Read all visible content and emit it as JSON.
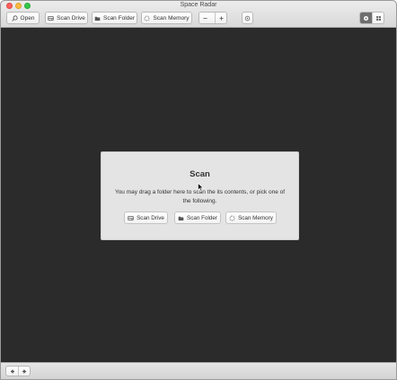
{
  "window": {
    "title": "Space Radar"
  },
  "toolbar": {
    "open_label": "Open",
    "scan_drive_label": "Scan Drive",
    "scan_folder_label": "Scan Folder",
    "scan_memory_label": "Scan Memory",
    "zoom_out_icon": "minus-icon",
    "zoom_in_icon": "plus-icon",
    "target_icon": "target-icon",
    "view_modes": [
      {
        "name": "sunburst-view",
        "icon": "sunburst-icon",
        "active": true
      },
      {
        "name": "treemap-view",
        "icon": "treemap-icon",
        "active": false
      }
    ]
  },
  "scan_panel": {
    "title": "Scan",
    "description": "You may drag a folder here to scan the its contents, or pick one of the following.",
    "buttons": {
      "scan_drive": "Scan Drive",
      "scan_folder": "Scan Folder",
      "scan_memory": "Scan Memory"
    }
  },
  "bottom_bar": {
    "back_icon": "arrow-left-icon",
    "forward_icon": "arrow-right-icon"
  },
  "colors": {
    "content_background": "#2b2b2b",
    "panel_background": "#e4e4e4",
    "active_toggle": "#6e6e6e",
    "close": "#fc605c",
    "minimize": "#fdbc40",
    "maximize": "#34c84a"
  }
}
